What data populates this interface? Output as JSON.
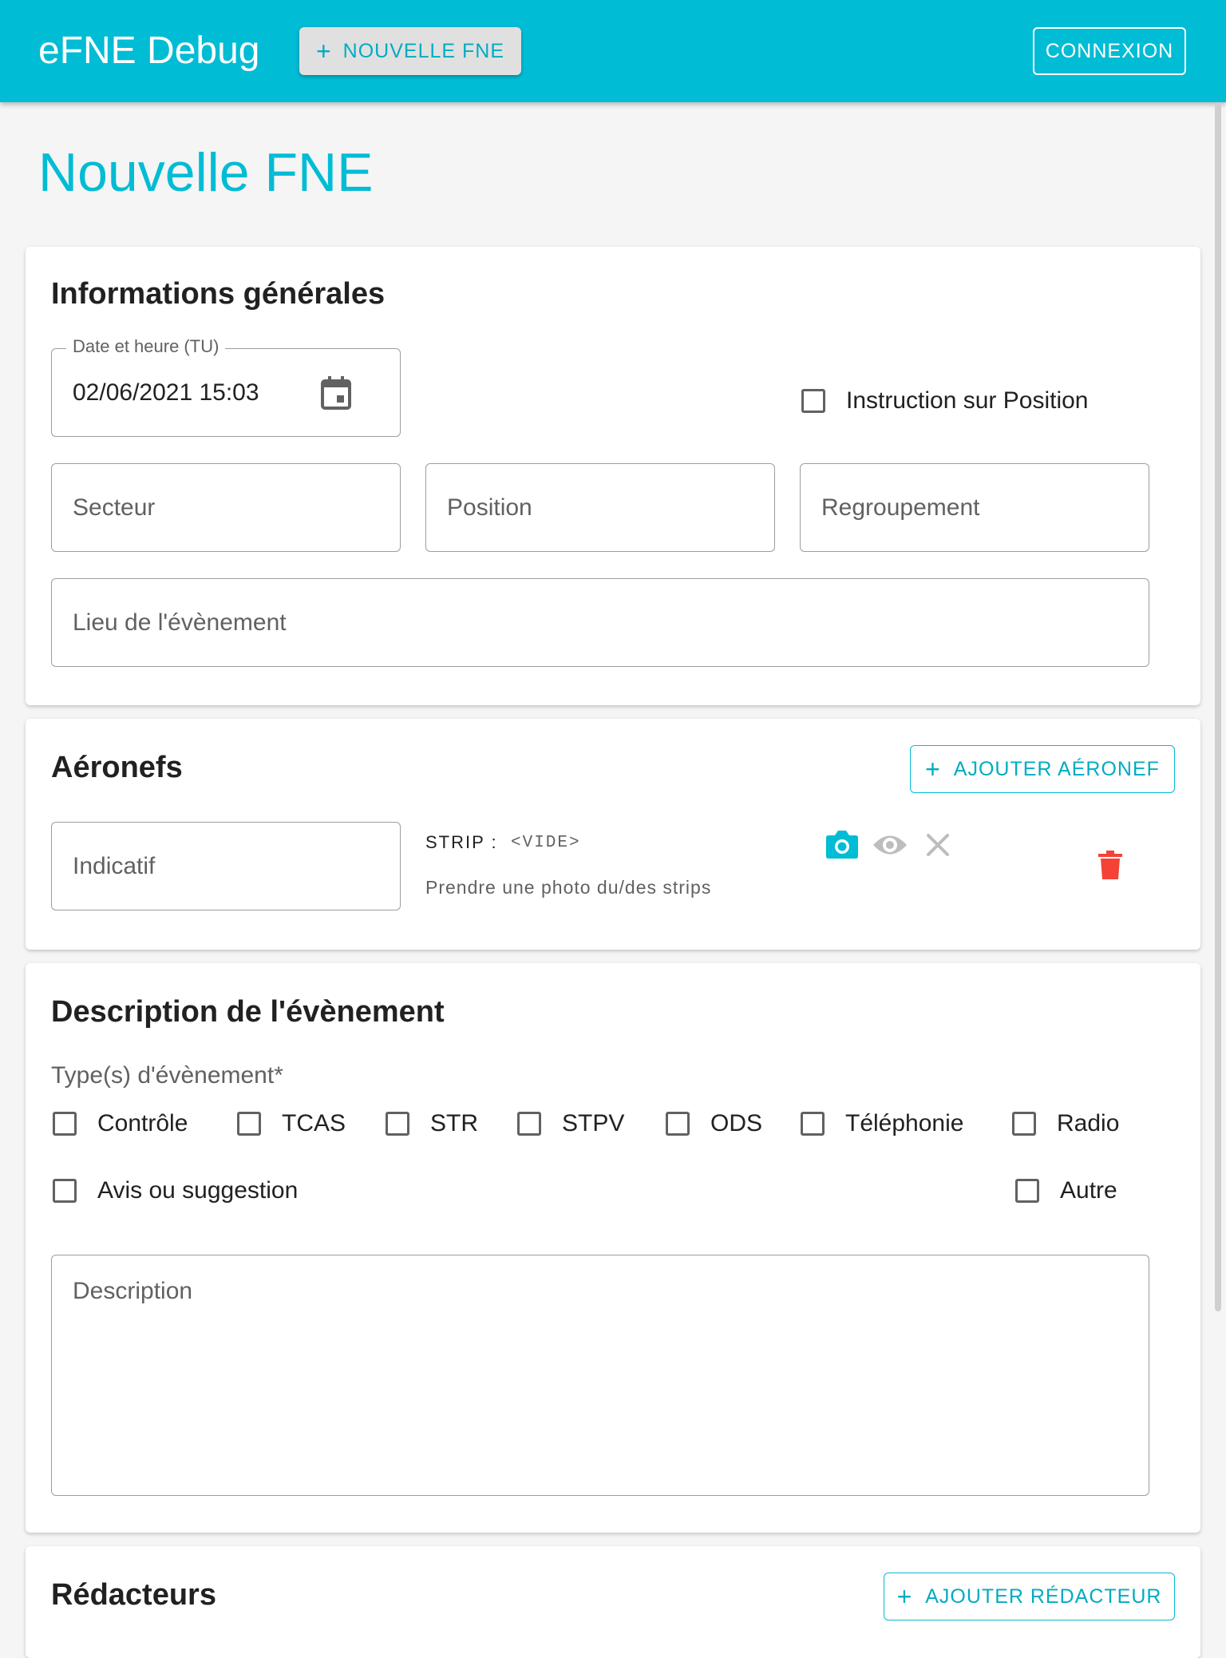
{
  "app": {
    "title": "eFNE Debug",
    "new_button": "NOUVELLE FNE",
    "login_button": "CONNEXION"
  },
  "page": {
    "title": "Nouvelle FNE"
  },
  "general": {
    "title": "Informations générales",
    "date_label": "Date et heure (TU)",
    "date_value": "02/06/2021 15:03",
    "instruction_label": "Instruction sur Position",
    "instruction_checked": false,
    "sector_placeholder": "Secteur",
    "position_placeholder": "Position",
    "grouping_placeholder": "Regroupement",
    "location_placeholder": "Lieu de l'évènement"
  },
  "aircraft": {
    "title": "Aéronefs",
    "add_button": "AJOUTER AÉRONEF",
    "callsign_placeholder": "Indicatif",
    "strip_label": "STRIP :",
    "strip_value": "<VIDE>",
    "strip_help": "Prendre une photo du/des strips"
  },
  "event": {
    "title": "Description de l'évènement",
    "types_label": "Type(s) d'évènement*",
    "types": [
      {
        "label": "Contrôle"
      },
      {
        "label": "TCAS"
      },
      {
        "label": "STR"
      },
      {
        "label": "STPV"
      },
      {
        "label": "ODS"
      },
      {
        "label": "Téléphonie"
      },
      {
        "label": "Radio"
      },
      {
        "label": "Avis ou suggestion"
      },
      {
        "label": "Autre"
      }
    ],
    "description_placeholder": "Description"
  },
  "writers": {
    "title": "Rédacteurs",
    "add_button": "AJOUTER RÉDACTEUR"
  },
  "colors": {
    "primary": "#00bcd4",
    "danger": "#f44336"
  }
}
